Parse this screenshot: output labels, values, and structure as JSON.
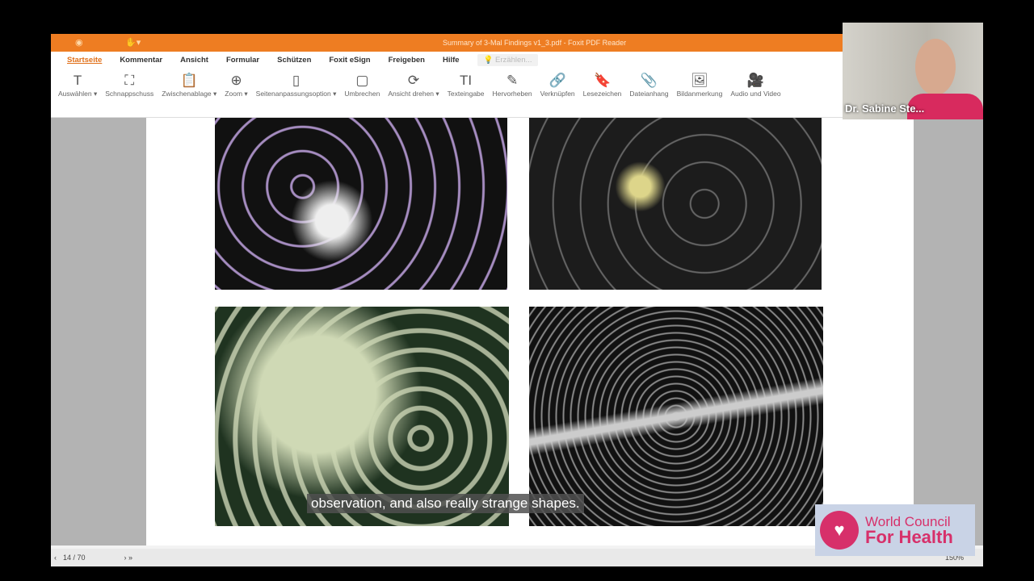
{
  "window": {
    "title": "Summary of 3-Mal Findings v1_3.pdf - Foxit PDF Reader"
  },
  "menu": [
    "Startseite",
    "Kommentar",
    "Ansicht",
    "Formular",
    "Schützen",
    "Foxit eSign",
    "Freigeben",
    "Hilfe"
  ],
  "search_placeholder": "Erzählen...",
  "tools": [
    {
      "icon": "T",
      "label": "Auswählen ▾"
    },
    {
      "icon": "⛶",
      "label": "Schnappschuss"
    },
    {
      "icon": "📋",
      "label": "Zwischenablage ▾"
    },
    {
      "icon": "⊕",
      "label": "Zoom ▾"
    },
    {
      "icon": "▯",
      "label": "Seitenanpassungsoption ▾"
    },
    {
      "icon": "▢",
      "label": "Umbrechen"
    },
    {
      "icon": "⟳",
      "label": "Ansicht drehen ▾"
    },
    {
      "icon": "TI",
      "label": "Texteingabe"
    },
    {
      "icon": "✎",
      "label": "Hervorheben"
    },
    {
      "icon": "🔗",
      "label": "Verknüpfen"
    },
    {
      "icon": "🔖",
      "label": "Lesezeichen"
    },
    {
      "icon": "📎",
      "label": "Dateianhang"
    },
    {
      "icon": "🖼",
      "label": "Bildanmerkung"
    },
    {
      "icon": "🎥",
      "label": "Audio und Video"
    }
  ],
  "caption": "observation, and also really strange shapes.",
  "status": {
    "page": "14 / 70",
    "zoom": "150%"
  },
  "webcam": {
    "name": "Dr. Sabine Ste..."
  },
  "brand": {
    "line1": "World Council",
    "line2": "For Health",
    "color": "#d7306a"
  }
}
